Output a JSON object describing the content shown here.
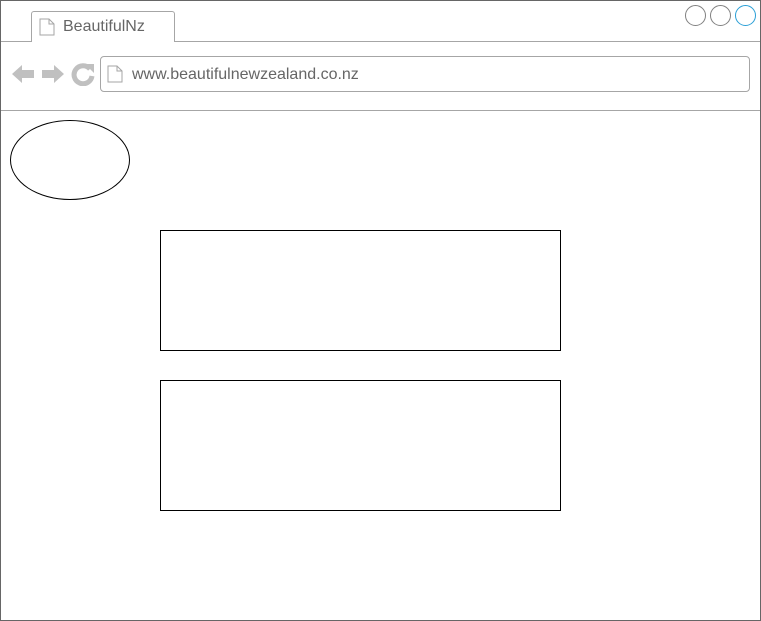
{
  "browser": {
    "tab": {
      "title": "BeautifulNz",
      "icon": "page-icon"
    },
    "window_controls": [
      {
        "name": "minimize",
        "icon": "circle-icon"
      },
      {
        "name": "maximize",
        "icon": "circle-icon"
      },
      {
        "name": "close",
        "icon": "circle-icon",
        "color": "#2a9fd6"
      }
    ],
    "nav": {
      "back_icon": "arrow-left-icon",
      "forward_icon": "arrow-right-icon",
      "reload_icon": "reload-icon"
    },
    "address_bar": {
      "url": "www.beautifulnewzealand.co.nz",
      "icon": "page-icon"
    }
  },
  "colors": {
    "chrome_border": "#a6a6a6",
    "icon_gray": "#c0c0c0",
    "text_gray": "#666666",
    "accent": "#2a9fd6"
  }
}
